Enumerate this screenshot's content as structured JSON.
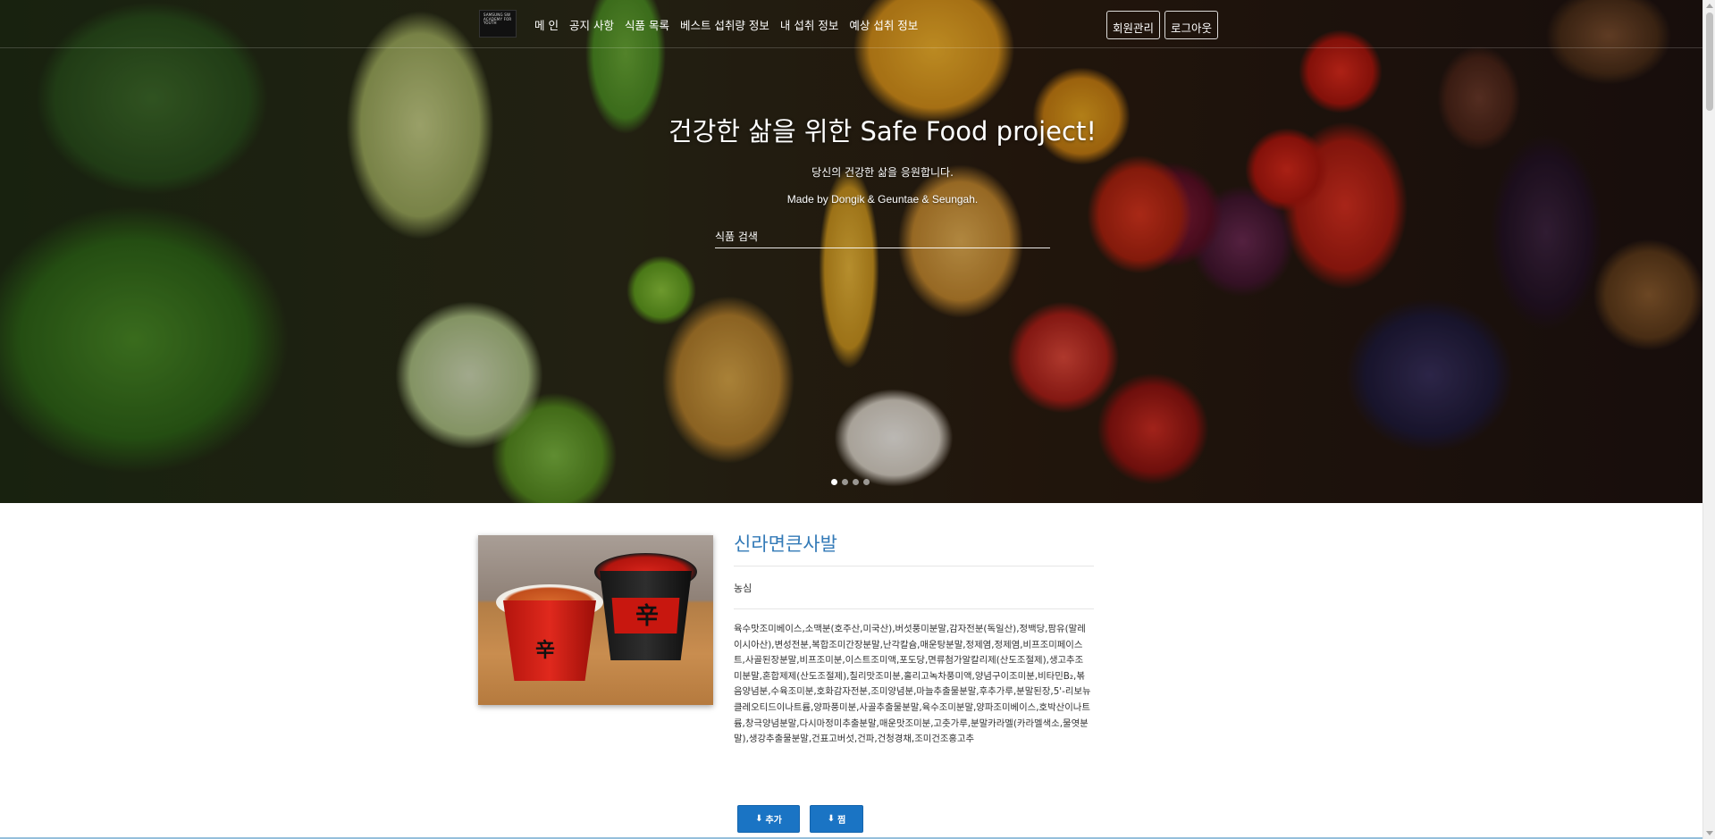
{
  "header": {
    "logo_text": "SAMSUNG SW ACADEMY FOR YOUTH",
    "nav_items": [
      "메 인",
      "공지 사항",
      "식품 목록",
      "베스트 섭취량 정보",
      "내 섭취 정보",
      "예상 섭취 정보"
    ],
    "buttons": {
      "member_manage": "회원관리",
      "logout": "로그아웃"
    }
  },
  "hero": {
    "title": "건강한 삶을 위한 Safe Food project!",
    "subtitle": "당신의 건강한 삶을 응원합니다.",
    "credit": "Made by Dongik & Geuntae & Seungah.",
    "search_placeholder": "식품 검색",
    "carousel": {
      "slide_count": 4,
      "active_index": 0
    }
  },
  "product": {
    "name": "신라면큰사발",
    "maker": "농심",
    "ingredients": "육수맛조미베이스,소맥분(호주산,미국산),버섯풍미분말,감자전분(독일산),정백당,팜유(말레이시아산),변성전분,복합조미간장분말,난각칼슘,매운탕분말,정제염,정제염,비프조미페이스트,사골된장분말,비프조미분,이스트조미액,포도당,면류첨가알칼리제(산도조절제),생고추조미분말,혼합제제(산도조절제),칠리맛조미분,홀리고녹차풍미액,양념구이조미분,비타민B₂,볶음양념분,수육조미분,호화감자전분,조미양념분,마늘추출물분말,후추가루,분말된장,5'-리보뉴클레오티드이나트륨,양파풍미분,사골추출물분말,육수조미분말,양파조미베이스,호박산이나트륨,창극양념분말,다시마정미추출분말,매운맛조미분,고춧가루,분말카라멜(카라멜색소,물엿분말),생강추출물분말,건표고버섯,건파,건청경채,조미건조홍고추",
    "image_labels": {
      "cup_mark": "辛"
    }
  },
  "actions": {
    "add_label": "추가",
    "pick_label": "찜"
  },
  "colors": {
    "accent": "#337ab7",
    "button_bg": "#1a74c4"
  }
}
